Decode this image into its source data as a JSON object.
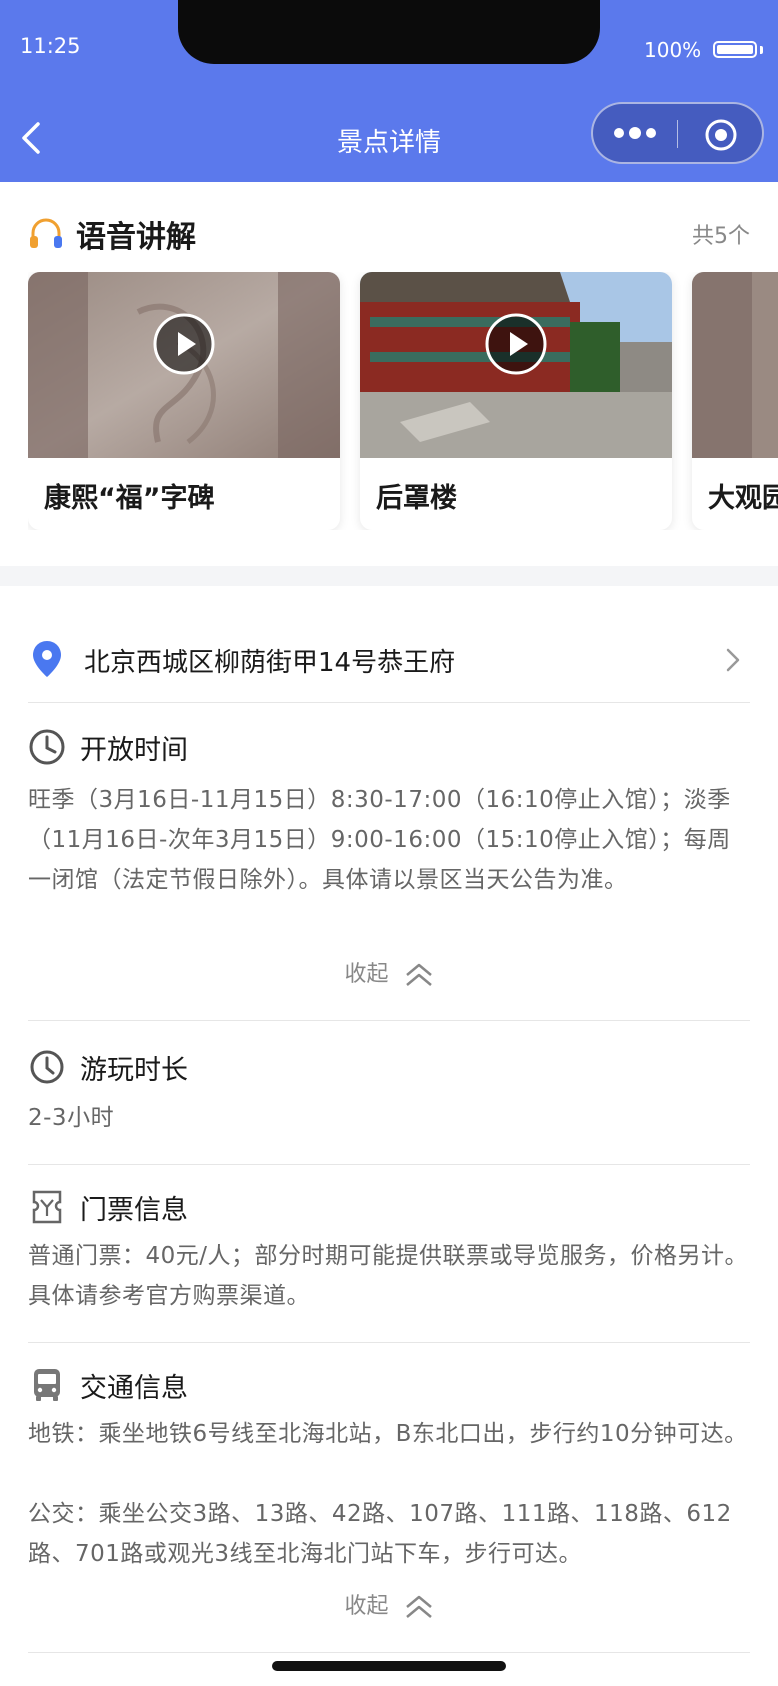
{
  "status": {
    "time": "11:25",
    "battery": "100%"
  },
  "nav": {
    "title": "景点详情"
  },
  "audio": {
    "title": "语音讲解",
    "count": "共5个",
    "items": [
      {
        "name": "康熙“福”字碑"
      },
      {
        "name": "后罩楼"
      },
      {
        "name": "大观园"
      }
    ]
  },
  "address": "北京西城区柳荫街甲14号恭王府",
  "opening": {
    "title": "开放时间",
    "text": "旺季（3月16日-11月15日）8:30-17:00（16:10停止入馆）；淡季（11月16日-次年3月15日）9:00-16:00（15:10停止入馆）；每周一闭馆（法定节假日除外）。具体请以景区当天公告为准。",
    "collapse": "收起"
  },
  "duration": {
    "title": "游玩时长",
    "text": "2-3小时"
  },
  "ticket": {
    "title": "门票信息",
    "text": "普通门票：40元/人；部分时期可能提供联票或导览服务，价格另计。具体请参考官方购票渠道。"
  },
  "transport": {
    "title": "交通信息",
    "subway": "地铁：乘坐地铁6号线至北海北站，B东北口出，步行约10分钟可达。",
    "bus": "公交：乘坐公交3路、13路、42路、107路、111路、118路、612路、701路或观光3线至北海北门站下车，步行可达。",
    "collapse": "收起"
  },
  "colors": {
    "header": "#5b79ec",
    "pin": "#4a78f0",
    "headphone": "#f0a030"
  }
}
